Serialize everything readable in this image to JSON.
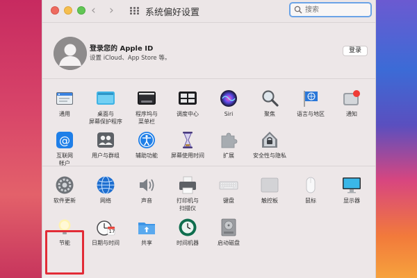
{
  "window": {
    "title": "系统偏好设置",
    "search_placeholder": "搜索"
  },
  "account": {
    "title": "登录您的 Apple ID",
    "subtitle": "设置 iCloud、App Store 等。",
    "login_button": "登录"
  },
  "row1": [
    {
      "label": "通用",
      "icon": "general-icon"
    },
    {
      "label": "桌面与\n屏幕保护程序",
      "icon": "desktop-screensaver-icon"
    },
    {
      "label": "程序坞与\n菜单栏",
      "icon": "dock-menubar-icon"
    },
    {
      "label": "调度中心",
      "icon": "mission-control-icon"
    },
    {
      "label": "Siri",
      "icon": "siri-icon"
    },
    {
      "label": "聚焦",
      "icon": "spotlight-icon"
    },
    {
      "label": "语言与地区",
      "icon": "language-region-icon"
    },
    {
      "label": "通知",
      "icon": "notifications-icon"
    }
  ],
  "row2": [
    {
      "label": "互联网\n帐户",
      "icon": "internet-accounts-icon"
    },
    {
      "label": "用户与群组",
      "icon": "users-groups-icon"
    },
    {
      "label": "辅助功能",
      "icon": "accessibility-icon"
    },
    {
      "label": "屏幕使用时间",
      "icon": "screen-time-icon"
    },
    {
      "label": "扩展",
      "icon": "extensions-icon"
    },
    {
      "label": "安全性与隐私",
      "icon": "security-privacy-icon"
    }
  ],
  "row3": [
    {
      "label": "软件更新",
      "icon": "software-update-icon"
    },
    {
      "label": "网络",
      "icon": "network-icon"
    },
    {
      "label": "声音",
      "icon": "sound-icon"
    },
    {
      "label": "打印机与\n扫描仪",
      "icon": "printers-scanners-icon"
    },
    {
      "label": "键盘",
      "icon": "keyboard-icon"
    },
    {
      "label": "触控板",
      "icon": "trackpad-icon"
    },
    {
      "label": "鼠标",
      "icon": "mouse-icon"
    },
    {
      "label": "显示器",
      "icon": "displays-icon"
    }
  ],
  "row4": [
    {
      "label": "节能",
      "icon": "energy-saver-icon"
    },
    {
      "label": "日期与时间",
      "icon": "date-time-icon"
    },
    {
      "label": "共享",
      "icon": "sharing-icon"
    },
    {
      "label": "时间机器",
      "icon": "time-machine-icon"
    },
    {
      "label": "启动磁盘",
      "icon": "startup-disk-icon"
    }
  ],
  "date_icon_day": "17",
  "colors": {
    "highlight": "#e22b36",
    "search_border": "#6aa3e7"
  }
}
